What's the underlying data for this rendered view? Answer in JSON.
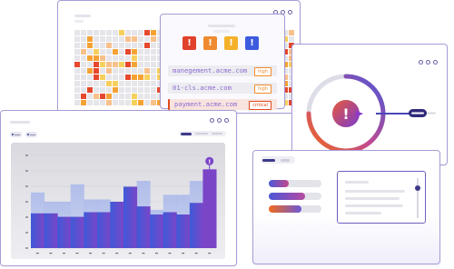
{
  "colors": {
    "accent": "#5a4fd0",
    "critical": "#e24a1a",
    "high": "#f28a2a",
    "domain_text": "#8e6ad0",
    "grid_gray": "#e5e5ea",
    "grid_orange": "#f5a235",
    "grid_red": "#e5482d",
    "grid_yellow": "#f7cf5d",
    "grid_peach": "#f8c08a"
  },
  "alert_icons": [
    {
      "name": "alert-red-icon",
      "glyph": "!",
      "color": "#e0412b"
    },
    {
      "name": "alert-orange-icon",
      "glyph": "!",
      "color": "#f08a2e"
    },
    {
      "name": "alert-yellow-icon",
      "glyph": "!",
      "color": "#f4b22a"
    },
    {
      "name": "alert-blue-icon",
      "glyph": "!",
      "color": "#3c5bde"
    }
  ],
  "findings": [
    {
      "domain": "manegement.acme.com",
      "severity": "high"
    },
    {
      "domain": "01-cls.acme.com",
      "severity": "high"
    },
    {
      "domain": "payment.acme.com",
      "severity": "critical"
    }
  ],
  "gauge": {
    "glyph": "!",
    "level_pct": 75
  },
  "chart_data": {
    "type": "bar",
    "categories": [
      "1",
      "2",
      "3",
      "4",
      "5",
      "6",
      "7",
      "8",
      "9",
      "10",
      "11",
      "12",
      "13",
      "14"
    ],
    "series": [
      {
        "values": [
          30,
          30,
          27,
          27,
          31,
          31,
          40,
          53,
          36,
          29,
          31,
          29,
          39,
          68
        ]
      },
      {
        "values": [
          48,
          40,
          40,
          55,
          42,
          42,
          38,
          32,
          58,
          33,
          46,
          46,
          58,
          58
        ]
      }
    ],
    "ylim": [
      0,
      80
    ],
    "marker_glyph": "!",
    "grid": true
  }
}
